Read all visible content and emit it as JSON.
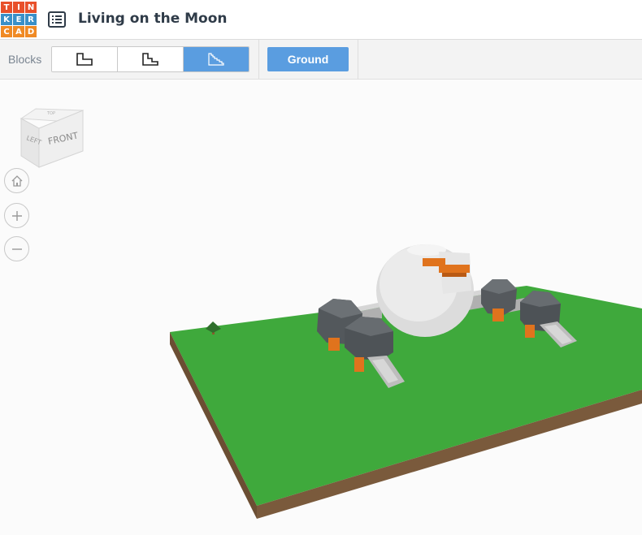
{
  "app": {
    "logo_letters": [
      "T",
      "I",
      "N",
      "K",
      "E",
      "R",
      "C",
      "A",
      "D"
    ],
    "logo_colors": [
      "#e8502a",
      "#e8502a",
      "#e8502a",
      "#3a90c8",
      "#3a90c8",
      "#3a90c8",
      "#f08a24",
      "#f08a24",
      "#f08a24"
    ],
    "title": "Living on the Moon"
  },
  "header": {
    "menu_icon": "list-icon"
  },
  "toolbar": {
    "blocks_label": "Blocks",
    "block_modes": [
      {
        "icon": "large-step-block-icon",
        "active": false
      },
      {
        "icon": "small-step-block-icon",
        "active": false
      },
      {
        "icon": "fine-step-block-icon",
        "active": true
      }
    ],
    "ground_label": "Ground"
  },
  "view_cube": {
    "left_label": "LEFT",
    "front_label": "FRONT",
    "top_label": "TOP"
  },
  "nav_controls": [
    {
      "icon": "home-icon"
    },
    {
      "icon": "zoom-in-icon"
    },
    {
      "icon": "zoom-out-icon"
    }
  ],
  "colors": {
    "accent": "#5a9de0",
    "ground_green": "#3fa93c",
    "ground_soil": "#7a5a3c",
    "dome_white": "#e4e4e4",
    "rock_grey": "#555a5e",
    "orange": "#e0731d"
  }
}
